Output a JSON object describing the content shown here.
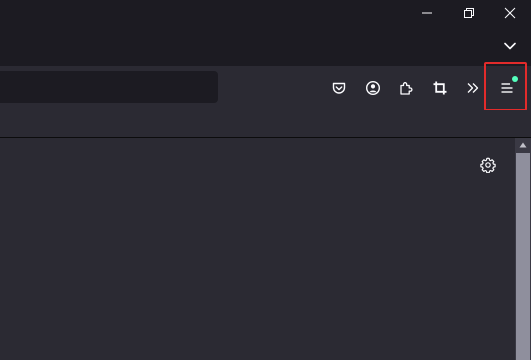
{
  "window": {
    "controls": [
      "minimize-icon",
      "restore-icon",
      "close-icon"
    ]
  },
  "toolbar": {
    "buttons": [
      "pocket-icon",
      "account-icon",
      "extensions-icon",
      "crop-icon",
      "overflow-icon",
      "hamburger-menu-icon"
    ],
    "menu_has_update_badge": true
  },
  "colors": {
    "titlebar": "#1c1b22",
    "toolbar": "#2b2a33",
    "content": "#2b2a33",
    "highlight": "#e22b2b",
    "badge": "#54ffbd",
    "icon": "#fbfbfe"
  },
  "content": {
    "settings_icon": "gear-icon"
  }
}
